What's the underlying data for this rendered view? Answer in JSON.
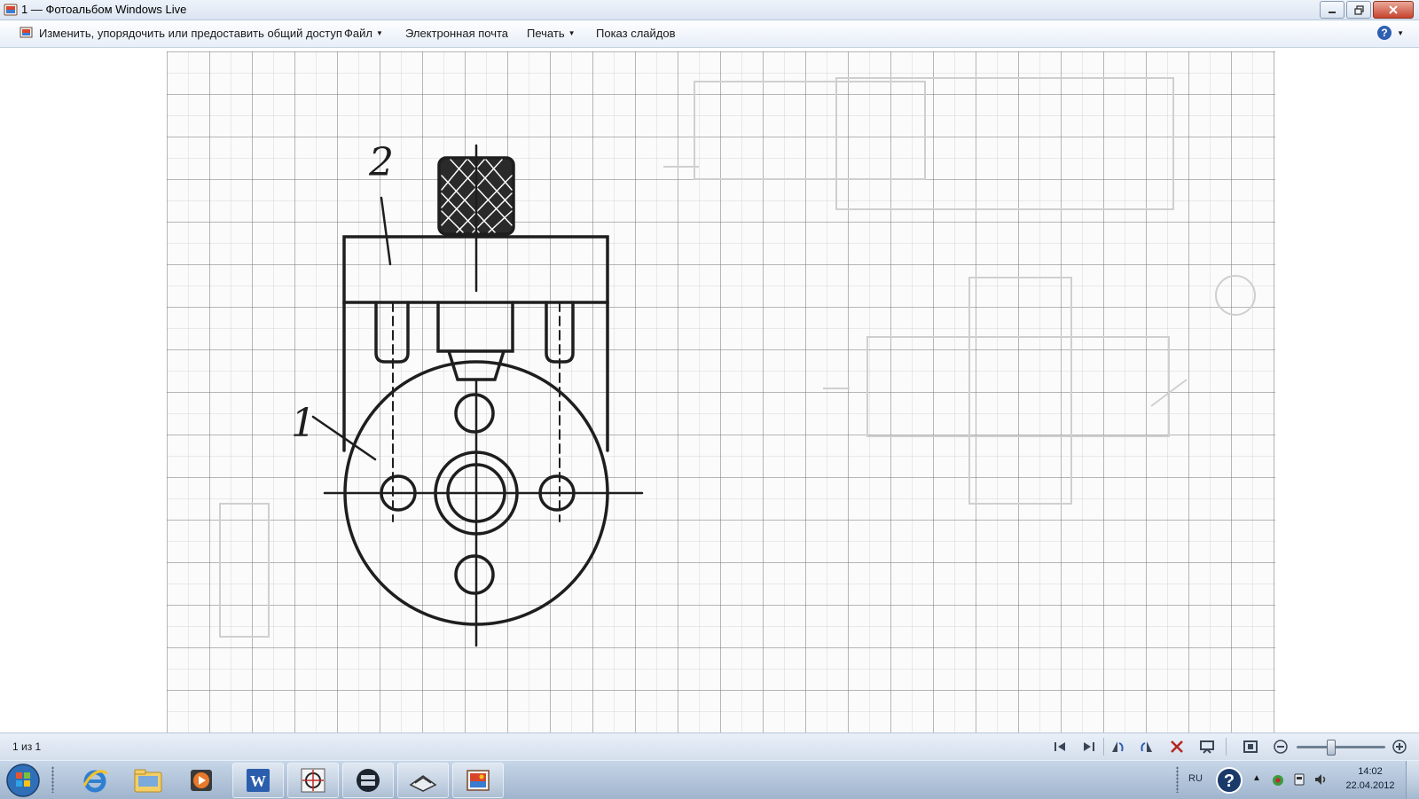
{
  "window": {
    "title": "1 — Фотоальбом Windows Live"
  },
  "commandbar": {
    "organize_label": "Изменить, упорядочить или предоставить общий доступ",
    "file_label": "Файл",
    "email_label": "Электронная почта",
    "print_label": "Печать",
    "slideshow_label": "Показ слайдов"
  },
  "photo": {
    "label_1": "1",
    "label_2": "2"
  },
  "statusbar": {
    "counter": "1 из 1"
  },
  "taskbar": {
    "items": [
      {
        "icon": "internet-explorer-icon"
      },
      {
        "icon": "windows-explorer-icon"
      },
      {
        "icon": "media-player-icon"
      },
      {
        "icon": "word-icon",
        "text": "W"
      },
      {
        "icon": "cad-icon"
      },
      {
        "icon": "calculator-app-icon"
      },
      {
        "icon": "scanner-icon"
      },
      {
        "icon": "photo-gallery-icon"
      }
    ],
    "language": "RU",
    "time": "14:02",
    "date": "22.04.2012"
  },
  "colors": {
    "ink": "#1e1e1e",
    "grid": "#8a8a8a",
    "taskbar": "#b3c6dd",
    "titlebar": "#dfe8f4"
  }
}
